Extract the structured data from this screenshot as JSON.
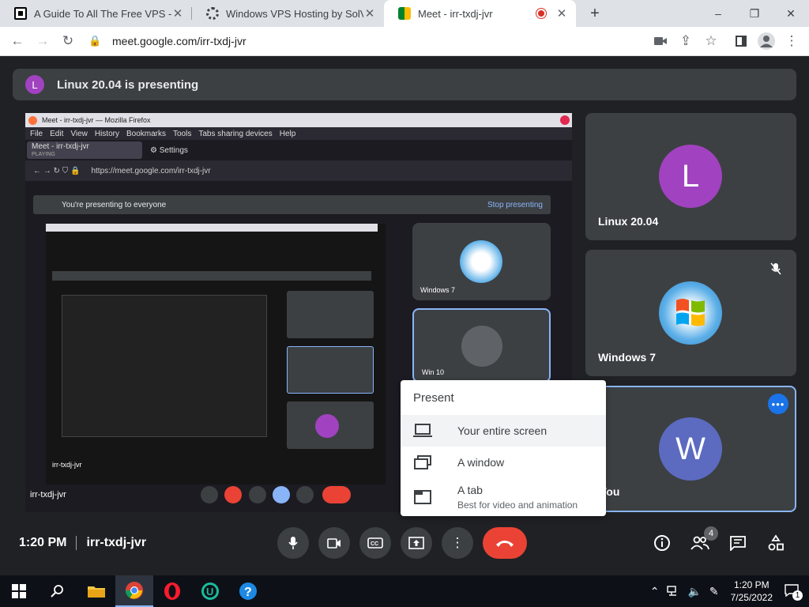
{
  "browser": {
    "tabs": [
      {
        "title": "A Guide To All The Free VPS - an",
        "favicon_color": "#000000"
      },
      {
        "title": "Windows VPS Hosting by SolVPS",
        "favicon_color": "#3c4043"
      },
      {
        "title": "Meet - irr-txdj-jvr",
        "favicon_color": "#00832d"
      }
    ],
    "new_tab": "+",
    "window_controls": [
      "–",
      "❐",
      "✕"
    ],
    "url": "meet.google.com/irr-txdj-jvr"
  },
  "meet": {
    "banner": {
      "avatar_letter": "L",
      "text": "Linux 20.04 is presenting"
    },
    "shared_window": {
      "title": "Meet - irr-txdj-jvr — Mozilla Firefox",
      "menu": [
        "File",
        "Edit",
        "View",
        "History",
        "Bookmarks",
        "Tools",
        "Tabs sharing devices",
        "Help"
      ],
      "tab1": "Meet - irr-txdj-jvr",
      "tab1_sub": "PLAYING",
      "tab2": "Settings",
      "url": "https://meet.google.com/irr-txdj-jvr",
      "presenting_text": "You're presenting to everyone",
      "stop_presenting": "Stop presenting",
      "tiles": [
        {
          "name": "Windows 7"
        },
        {
          "name": "Win 10"
        }
      ],
      "meeting_code": "irr-txdj-jvr",
      "inner_code": "irr-txdj-jvr"
    },
    "participants": [
      {
        "name": "Linux 20.04",
        "letter": "L",
        "color": "#a142c0"
      },
      {
        "name": "Windows 7",
        "letter": "",
        "color": "#1a73e8"
      },
      {
        "name": "You",
        "letter": "W",
        "color": "#5c6bc0"
      }
    ],
    "present_menu": {
      "heading": "Present",
      "items": [
        {
          "label": "Your entire screen",
          "sub": ""
        },
        {
          "label": "A window",
          "sub": ""
        },
        {
          "label": "A tab",
          "sub": "Best for video and animation"
        }
      ]
    },
    "bottom": {
      "time": "1:20 PM",
      "code": "irr-txdj-jvr",
      "people_count": "4"
    }
  },
  "taskbar": {
    "time": "1:20 PM",
    "date": "7/25/2022",
    "notif_count": "1"
  }
}
